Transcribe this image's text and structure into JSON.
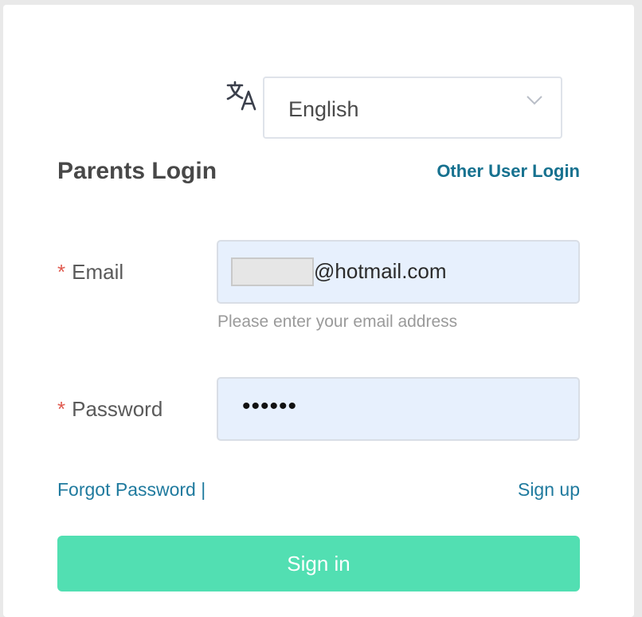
{
  "language": {
    "icon": "translate-icon",
    "selected": "English"
  },
  "header": {
    "title": "Parents Login",
    "other_login": "Other User Login"
  },
  "form": {
    "email": {
      "required_mark": "*",
      "label": "Email",
      "value_suffix": "@hotmail.com",
      "hint": "Please enter your email address"
    },
    "password": {
      "required_mark": "*",
      "label": "Password",
      "masked_value": "••••••"
    }
  },
  "links": {
    "forgot": "Forgot Password |",
    "signup": "Sign up"
  },
  "submit": {
    "label": "Sign in",
    "color": "#52dfb2"
  },
  "colors": {
    "link": "#1f7a9e",
    "required": "#e05a4f",
    "input_bg": "#e7f0fd"
  }
}
